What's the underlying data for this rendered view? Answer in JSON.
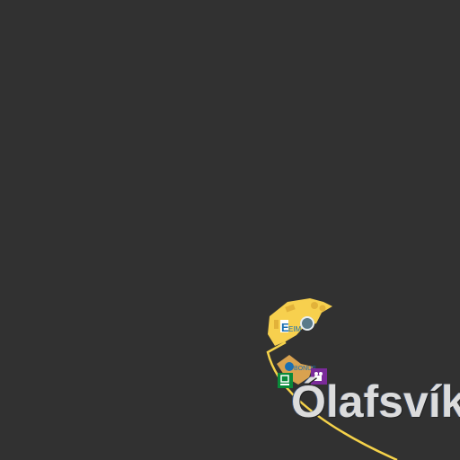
{
  "map": {
    "background_color": "#313131",
    "road_color": "#f5d24a",
    "place_label": "Ólafsvík",
    "icons": [
      {
        "name": "shop-icon",
        "color": "#1a6fb3"
      },
      {
        "name": "cloud-icon",
        "color": "#5a7a8a"
      },
      {
        "name": "computer-icon",
        "color": "#0a8a3a"
      },
      {
        "name": "cinema-icon",
        "color": "#7a2a9a"
      }
    ]
  }
}
